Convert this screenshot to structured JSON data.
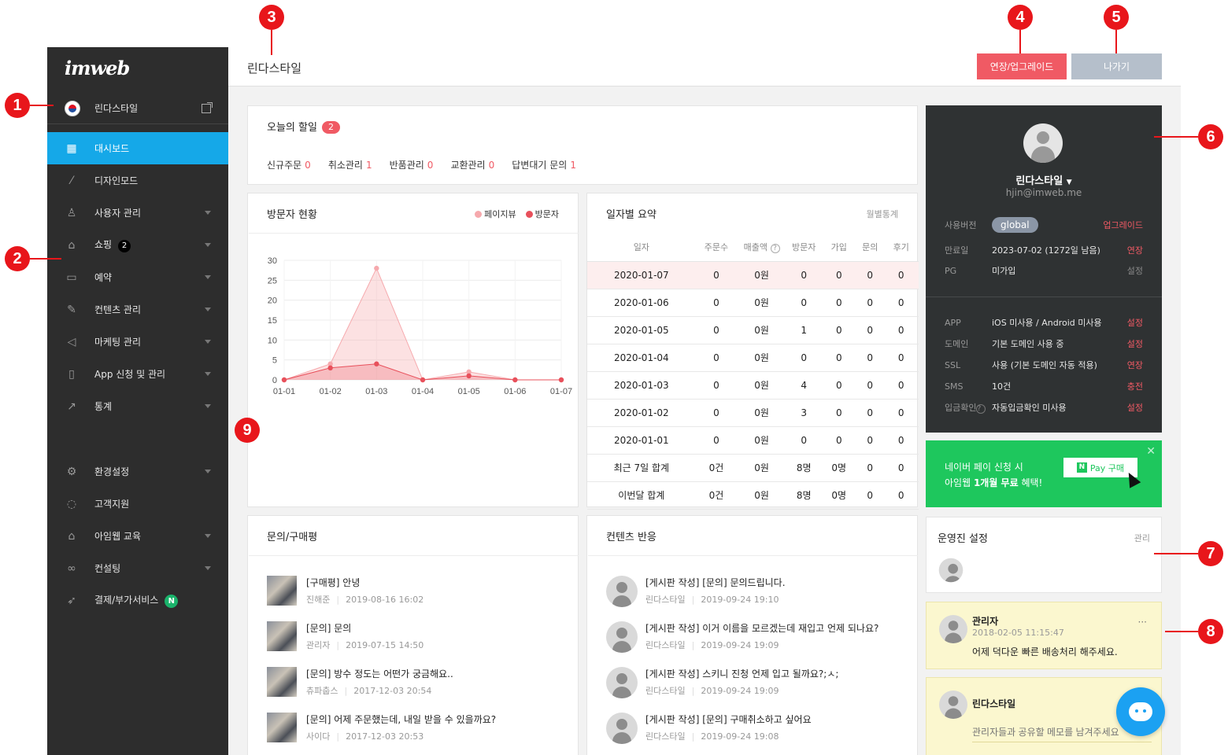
{
  "markers": [
    "1",
    "2",
    "3",
    "4",
    "5",
    "6",
    "7",
    "8",
    "9"
  ],
  "sidebar": {
    "logo": "imweb",
    "site_name": "린다스타일",
    "items": [
      {
        "label": "대시보드",
        "icon": "dashboard-icon"
      },
      {
        "label": "디자인모드",
        "icon": "magic-wand-icon"
      },
      {
        "label": "사용자 관리",
        "icon": "user-icon"
      },
      {
        "label": "쇼핑",
        "icon": "shopping-bag-icon",
        "badge": "2"
      },
      {
        "label": "예약",
        "icon": "calendar-icon"
      },
      {
        "label": "컨텐츠 관리",
        "icon": "edit-icon"
      },
      {
        "label": "마케팅 관리",
        "icon": "megaphone-icon"
      },
      {
        "label": "App 신청 및 관리",
        "icon": "mobile-icon"
      },
      {
        "label": "통계",
        "icon": "chart-icon"
      },
      {
        "label": "환경설정",
        "icon": "gear-icon"
      },
      {
        "label": "고객지원",
        "icon": "chat-icon"
      },
      {
        "label": "아임웹 교육",
        "icon": "graduation-cap-icon"
      },
      {
        "label": "컨설팅",
        "icon": "glasses-icon"
      },
      {
        "label": "결제/부가서비스",
        "icon": "rocket-icon",
        "badge": "N"
      }
    ]
  },
  "topbar": {
    "title": "린다스타일",
    "extend_label": "연장/업그레이드",
    "exit_label": "나가기"
  },
  "todo": {
    "title": "오늘의 할일",
    "count": "2",
    "items": [
      {
        "label": "신규주문",
        "value": "0"
      },
      {
        "label": "취소관리",
        "value": "1"
      },
      {
        "label": "반품관리",
        "value": "0"
      },
      {
        "label": "교환관리",
        "value": "0"
      },
      {
        "label": "답변대기 문의",
        "value": "1"
      }
    ]
  },
  "visitors": {
    "title": "방문자 현황",
    "legend": [
      "페이지뷰",
      "방문자"
    ]
  },
  "chart_data": {
    "type": "area",
    "x": [
      "01-01",
      "01-02",
      "01-03",
      "01-04",
      "01-05",
      "01-06",
      "01-07"
    ],
    "series": [
      {
        "name": "페이지뷰",
        "values": [
          0,
          4,
          28,
          0,
          2,
          0,
          0
        ],
        "color": "#f6a9ad"
      },
      {
        "name": "방문자",
        "values": [
          0,
          3,
          4,
          0,
          1,
          0,
          0
        ],
        "color": "#e8505b"
      }
    ],
    "ylim": [
      0,
      30
    ],
    "yticks": [
      0,
      5,
      10,
      15,
      20,
      25,
      30
    ],
    "grid": true,
    "legend": "top-right"
  },
  "daily": {
    "title": "일자별 요약",
    "link": "월별통계",
    "headers": [
      "일자",
      "주문수",
      "매출액",
      "방문자",
      "가입",
      "문의",
      "후기"
    ],
    "rows": [
      [
        "2020-01-07",
        "0",
        "0원",
        "0",
        "0",
        "0",
        "0"
      ],
      [
        "2020-01-06",
        "0",
        "0원",
        "0",
        "0",
        "0",
        "0"
      ],
      [
        "2020-01-05",
        "0",
        "0원",
        "1",
        "0",
        "0",
        "0"
      ],
      [
        "2020-01-04",
        "0",
        "0원",
        "0",
        "0",
        "0",
        "0"
      ],
      [
        "2020-01-03",
        "0",
        "0원",
        "4",
        "0",
        "0",
        "0"
      ],
      [
        "2020-01-02",
        "0",
        "0원",
        "3",
        "0",
        "0",
        "0"
      ],
      [
        "2020-01-01",
        "0",
        "0원",
        "0",
        "0",
        "0",
        "0"
      ],
      [
        "최근 7일 합계",
        "0건",
        "0원",
        "8명",
        "0명",
        "0",
        "0"
      ],
      [
        "이번달 합계",
        "0건",
        "0원",
        "8명",
        "0명",
        "0",
        "0"
      ]
    ]
  },
  "inquiries": {
    "title": "문의/구매평",
    "items": [
      {
        "title": "[구매평] 안녕",
        "author": "진해준",
        "date": "2019-08-16 16:02"
      },
      {
        "title": "[문의] 문의",
        "author": "관리자",
        "date": "2019-07-15 14:50"
      },
      {
        "title": "[문의] 방수 정도는 어떤가 궁금해요..",
        "author": "츄파춥스",
        "date": "2017-12-03 20:54"
      },
      {
        "title": "[문의] 어제 주문했는데, 내일 받을 수 있을까요?",
        "author": "사이다",
        "date": "2017-12-03 20:53"
      }
    ]
  },
  "reactions": {
    "title": "컨텐츠 반응",
    "items": [
      {
        "title": "[게시판 작성] [문의] 문의드립니다.",
        "author": "린다스타일",
        "date": "2019-09-24 19:10"
      },
      {
        "title": "[게시판 작성] 이거 이름을 모르겠는데 재입고 언제 되나요?",
        "author": "린다스타일",
        "date": "2019-09-24 19:09"
      },
      {
        "title": "[게시판 작성] 스키니 진청 언제 입고 될까요?;ㅅ;",
        "author": "린다스타일",
        "date": "2019-09-24 19:09"
      },
      {
        "title": "[게시판 작성] [문의] 구매취소하고 싶어요",
        "author": "린다스타일",
        "date": "2019-09-24 19:08"
      }
    ]
  },
  "profile": {
    "name": "린다스타일",
    "email": "hjin@imweb.me",
    "version_key": "사용버전",
    "version_value": "global",
    "version_action": "업그레이드",
    "expire_key": "만료일",
    "expire_value": "2023-07-02 (1272일 남음)",
    "expire_action": "연장",
    "pg_key": "PG",
    "pg_value": "미가입",
    "pg_action": "설정",
    "services": [
      {
        "key": "APP",
        "value": "iOS 미사용 / Android 미사용",
        "action": "설정"
      },
      {
        "key": "도메인",
        "value": "기본 도메인 사용 중",
        "action": "설정"
      },
      {
        "key": "SSL",
        "value": "사용 (기본 도메인 자동 적용)",
        "action": "연장"
      },
      {
        "key": "SMS",
        "value": "10건",
        "action": "충전"
      },
      {
        "key": "입금확인",
        "value": "자동입금확인 미사용",
        "action": "설정"
      }
    ]
  },
  "npay": {
    "line1": "네이버 페이 신청 시",
    "line2_pre": "아임웹 ",
    "line2_bold": "1개월 무료",
    "line2_post": " 혜택!",
    "button_n": "N",
    "button_label": "Pay 구매"
  },
  "operators": {
    "title": "운영진 설정",
    "link": "관리"
  },
  "memo1": {
    "author": "관리자",
    "date": "2018-02-05 11:15:47",
    "text": "어제 덕다운 빠른 배송처리 해주세요.",
    "more": "···"
  },
  "memo2": {
    "author": "린다스타일",
    "placeholder": "관리자들과 공유할 메모를 남겨주세요"
  }
}
